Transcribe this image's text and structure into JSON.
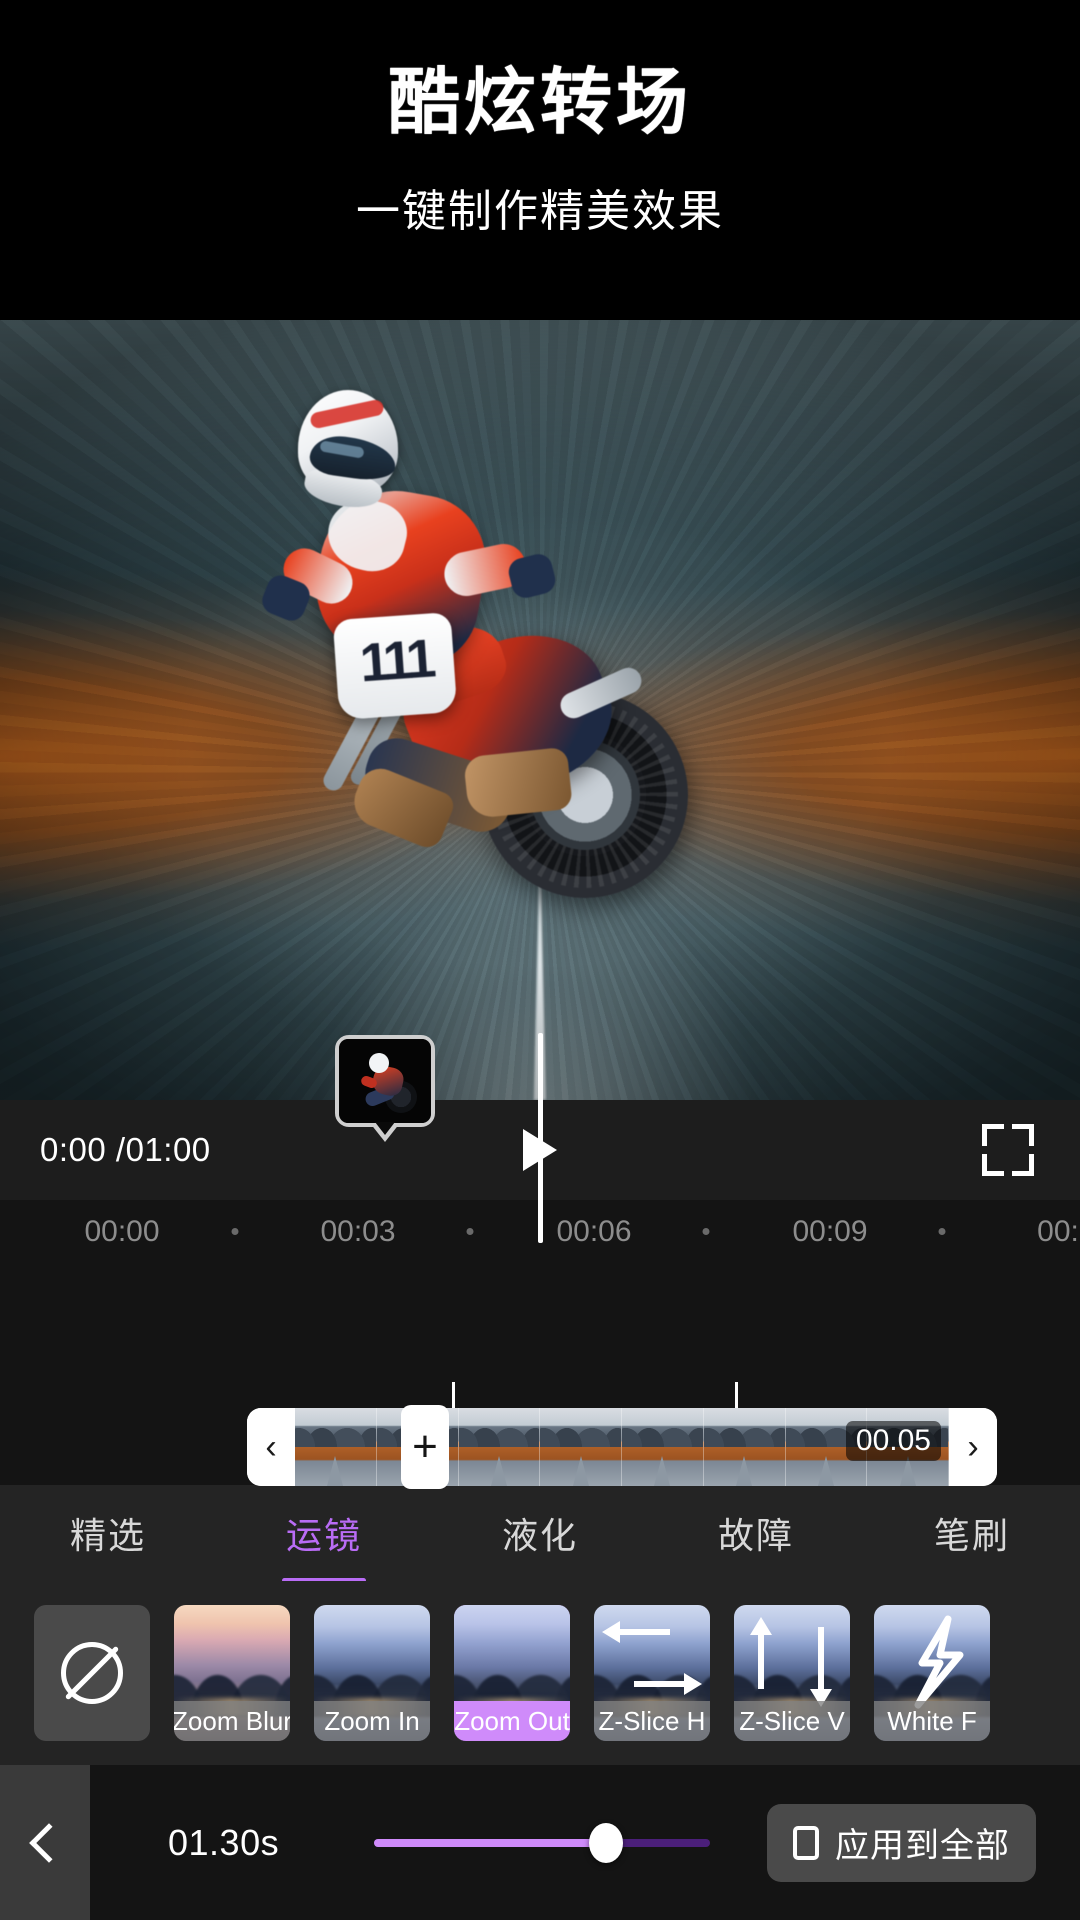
{
  "promo": {
    "title": "酷炫转场",
    "subtitle": "一键制作精美效果"
  },
  "player": {
    "current_time": "0:00",
    "total_time": "/01:00",
    "time_display": "0:00 /01:00",
    "play_icon": "play-icon",
    "fullscreen_icon": "fullscreen-icon"
  },
  "timeline": {
    "ruler_labels": [
      "00:00",
      "00:03",
      "00:06",
      "00:09",
      "00:"
    ],
    "clip_duration_badge": "00.05",
    "split_button_label": "+",
    "left_handle_label": "‹",
    "right_handle_label": "›",
    "frame_count": 8
  },
  "tabs": [
    {
      "label": "精选",
      "active": false
    },
    {
      "label": "运镜",
      "active": true
    },
    {
      "label": "液化",
      "active": false
    },
    {
      "label": "故障",
      "active": false
    },
    {
      "label": "笔刷",
      "active": false
    }
  ],
  "effects": [
    {
      "label": "",
      "icon": "no-effect-icon",
      "type": "none",
      "selected": false
    },
    {
      "label": "Zoom Blur",
      "type": "warm",
      "selected": false
    },
    {
      "label": "Zoom In",
      "type": "cool",
      "selected": false
    },
    {
      "label": "Zoom Out",
      "type": "purple",
      "selected": true
    },
    {
      "label": "Z-Slice H",
      "type": "cool",
      "selected": false,
      "overlay": "arrows-horizontal"
    },
    {
      "label": "Z-Slice V",
      "type": "cool",
      "selected": false,
      "overlay": "arrows-vertical"
    },
    {
      "label": "White F",
      "type": "cool",
      "selected": false,
      "overlay": "lightning"
    }
  ],
  "bottom": {
    "back_icon": "chevron-left-icon",
    "duration_value": "01.30s",
    "slider_percent": 69,
    "apply_all_label": "应用到全部",
    "apply_all_icon": "phone-outline-icon"
  },
  "colors": {
    "accent": "#b96cf5",
    "accent_light": "#cf8bfa",
    "slider_track": "#4b1f7a",
    "panel": "#242424",
    "bar": "#141414",
    "playbar": "#1d1d1d"
  }
}
